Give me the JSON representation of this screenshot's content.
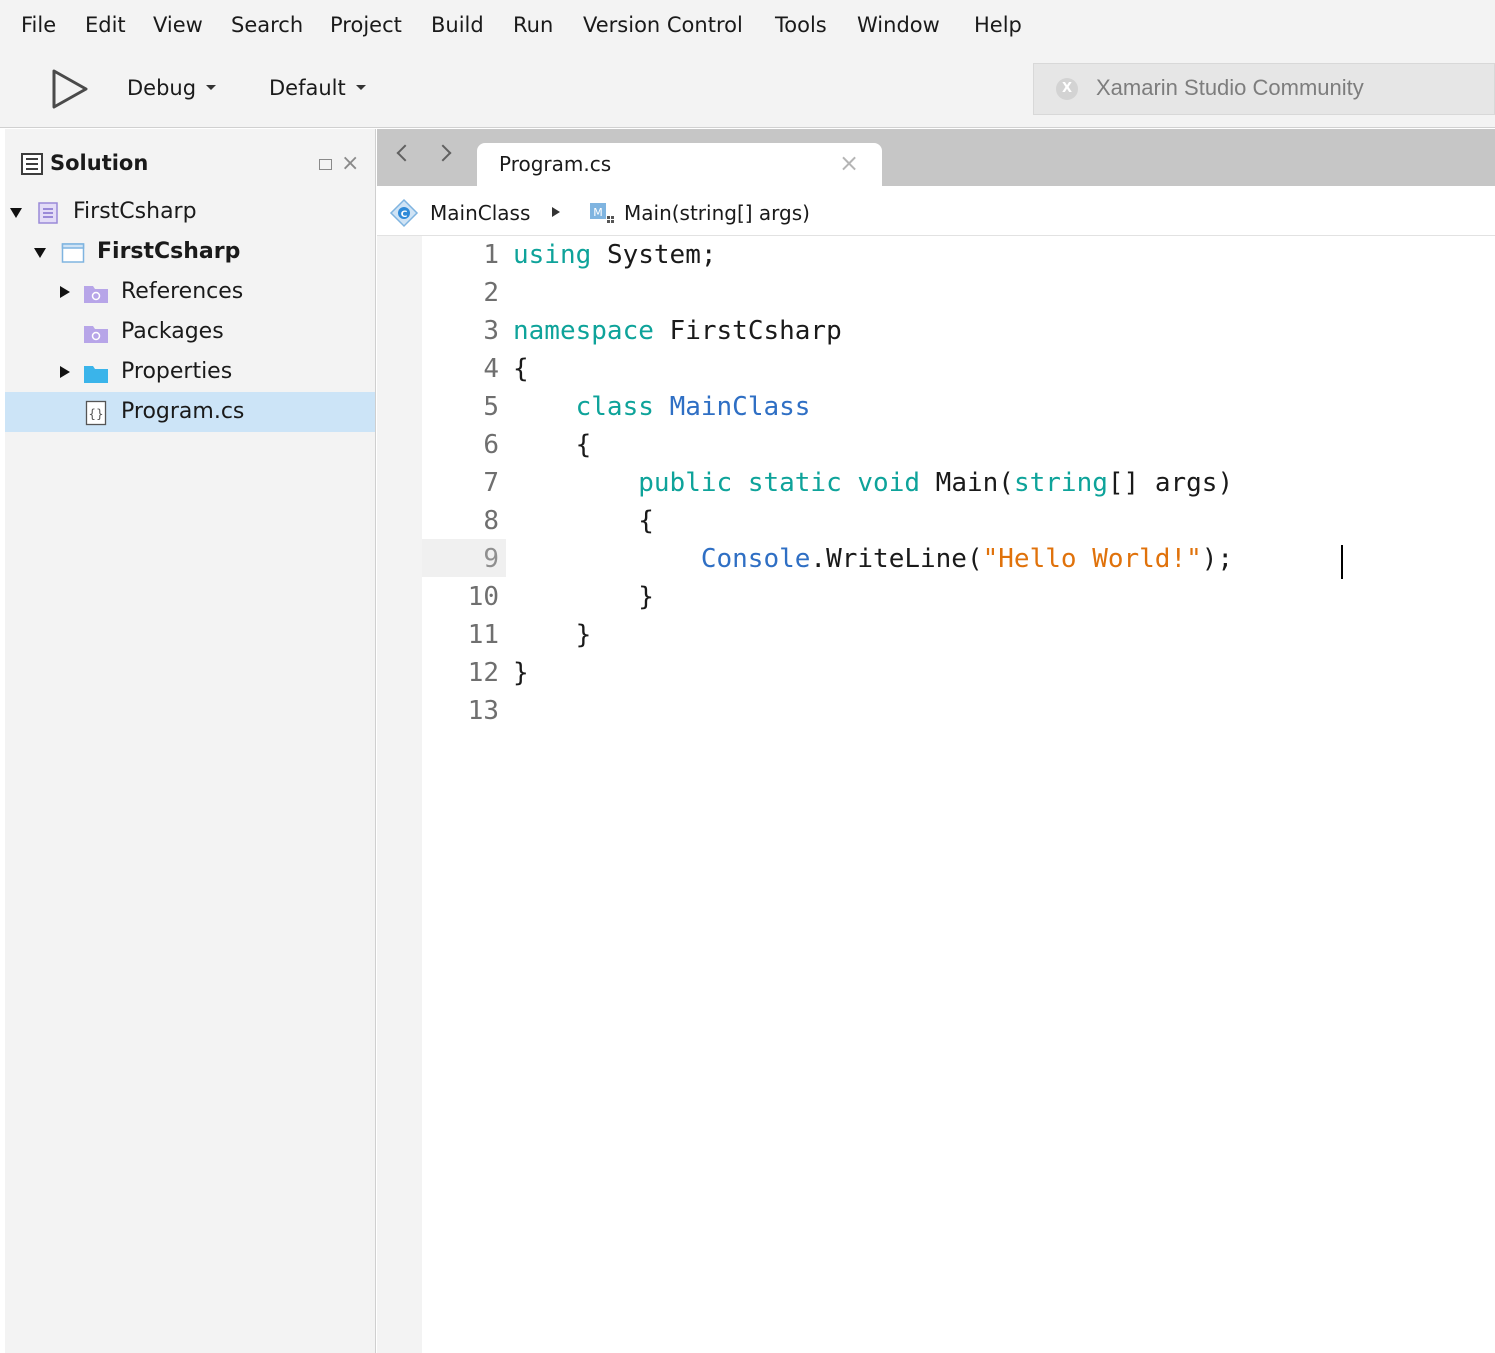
{
  "menubar": {
    "items": [
      "File",
      "Edit",
      "View",
      "Search",
      "Project",
      "Build",
      "Run",
      "Version Control",
      "Tools",
      "Window",
      "Help"
    ]
  },
  "toolbar": {
    "run_icon": "play-icon",
    "configuration": "Debug",
    "target": "Default",
    "status_icon": "xamarin-icon",
    "status_text": "Xamarin Studio Community"
  },
  "solution_pad": {
    "title": "Solution",
    "tree": [
      {
        "label": "FirstCsharp",
        "icon": "solution-icon",
        "expanded": true
      },
      {
        "label": "FirstCsharp",
        "icon": "project-icon",
        "expanded": true,
        "bold": true
      },
      {
        "label": "References",
        "icon": "references-folder-icon",
        "expanded": false
      },
      {
        "label": "Packages",
        "icon": "packages-folder-icon"
      },
      {
        "label": "Properties",
        "icon": "folder-icon",
        "expanded": false
      },
      {
        "label": "Program.cs",
        "icon": "csharp-file-icon",
        "selected": true
      }
    ]
  },
  "editor": {
    "tab": {
      "label": "Program.cs"
    },
    "path": {
      "class": "MainClass",
      "method": "Main(string[] args)"
    },
    "current_line": 9,
    "lines": [
      {
        "num": "1",
        "code": "using System;"
      },
      {
        "num": "2",
        "code": ""
      },
      {
        "num": "3",
        "code": "namespace FirstCsharp"
      },
      {
        "num": "4",
        "code": "{"
      },
      {
        "num": "5",
        "code": "    class MainClass"
      },
      {
        "num": "6",
        "code": "    {"
      },
      {
        "num": "7",
        "code": "        public static void Main(string[] args)"
      },
      {
        "num": "8",
        "code": "        {"
      },
      {
        "num": "9",
        "code": "            Console.WriteLine(\"Hello World!\");"
      },
      {
        "num": "10",
        "code": "        }"
      },
      {
        "num": "11",
        "code": "    }"
      },
      {
        "num": "12",
        "code": "}"
      },
      {
        "num": "13",
        "code": ""
      }
    ]
  },
  "colors": {
    "keyword": "#0ea39a",
    "type": "#2f6fc4",
    "string": "#e0720b",
    "selection": "#cce4f7"
  }
}
